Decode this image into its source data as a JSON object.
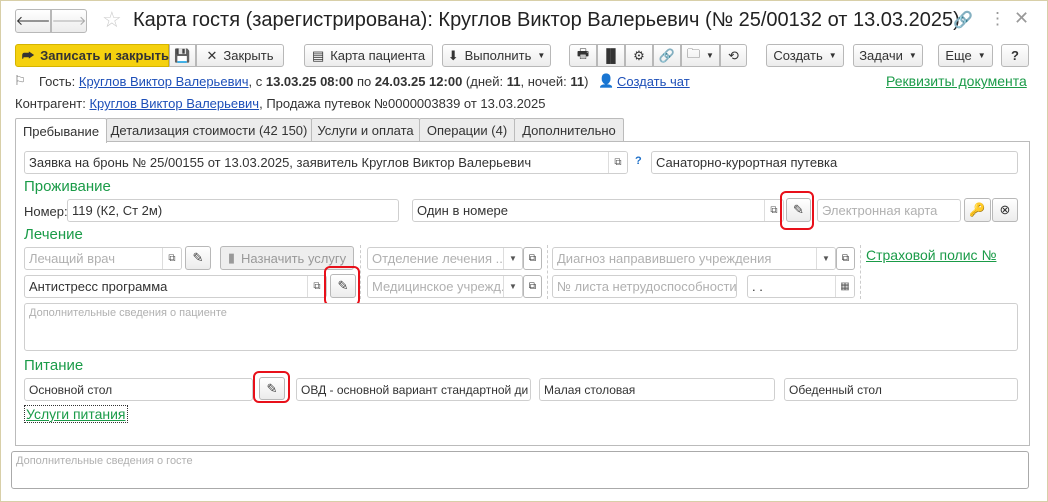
{
  "title": "Карта гостя (зарегистрирована): Круглов Виктор Валерьевич (№ 25/00132 от 13.03.2025)",
  "toolbar": {
    "save_close": "Записать и закрыть",
    "close": "Закрыть",
    "patient_card": "Карта пациента",
    "execute": "Выполнить",
    "create": "Создать",
    "tasks": "Задачи",
    "more": "Еще",
    "help": "?"
  },
  "info": {
    "guest_label": "Гость:",
    "guest_name": "Круглов Виктор Валерьевич",
    "from_pre": ", с ",
    "from": "13.03.25 08:00",
    "to_pre": " по ",
    "to": "24.03.25 12:00",
    "days_pre": " (дней: ",
    "days": "11",
    "nights_pre": ", ночей: ",
    "nights": "11",
    "close_paren": ")",
    "create_chat": "Создать чат",
    "doc_details": "Реквизиты документа",
    "contractor_label": "Контрагент:",
    "contractor_name": "Круглов Виктор Валерьевич",
    "contractor_rest": ", Продажа путевок №0000003839 от 13.03.2025"
  },
  "tabs": [
    "Пребывание",
    "Детализация стоимости (42 150)",
    "Услуги и оплата",
    "Операции (4)",
    "Дополнительно"
  ],
  "main": {
    "booking": "Заявка на бронь № 25/00155 от 13.03.2025, заявитель Круглов Виктор Валерьевич",
    "help_mark": "?",
    "voucher": "Санаторно-курортная путевка",
    "accommodation": "Проживание",
    "room_label": "Номер:",
    "room": "119 (К2, Ст 2м)",
    "occupancy": "Один в номере",
    "ecard_ph": "Электронная карта",
    "treatment": "Лечение",
    "doctor_ph": "Лечащий врач",
    "assign_service": "Назначить услугу",
    "department_ph": "Отделение лечения ...",
    "diagnosis_ph": "Диагноз направившего учреждения",
    "insurance": "Страховой полис №",
    "program": "Антистресс программа",
    "med_inst_ph": "Медицинское учрежд...",
    "sick_list_ph": "№ листа нетрудоспособности",
    "date": " .  .",
    "patient_notes_ph": "Дополнительные сведения о пациенте",
    "nutrition": "Питание",
    "diet": "Основной стол",
    "diet_variant": "ОВД - основной вариант стандартной ди",
    "dining_room": "Малая столовая",
    "meal_table": "Обеденный стол",
    "nutrition_services": "Услуги питания",
    "guest_notes_ph": "Дополнительные сведения о госте"
  },
  "colors": {
    "accent_yellow": "#f5d10f",
    "green": "#1a9b48",
    "link": "#1d4fb8",
    "highlight": "#e8101a"
  }
}
